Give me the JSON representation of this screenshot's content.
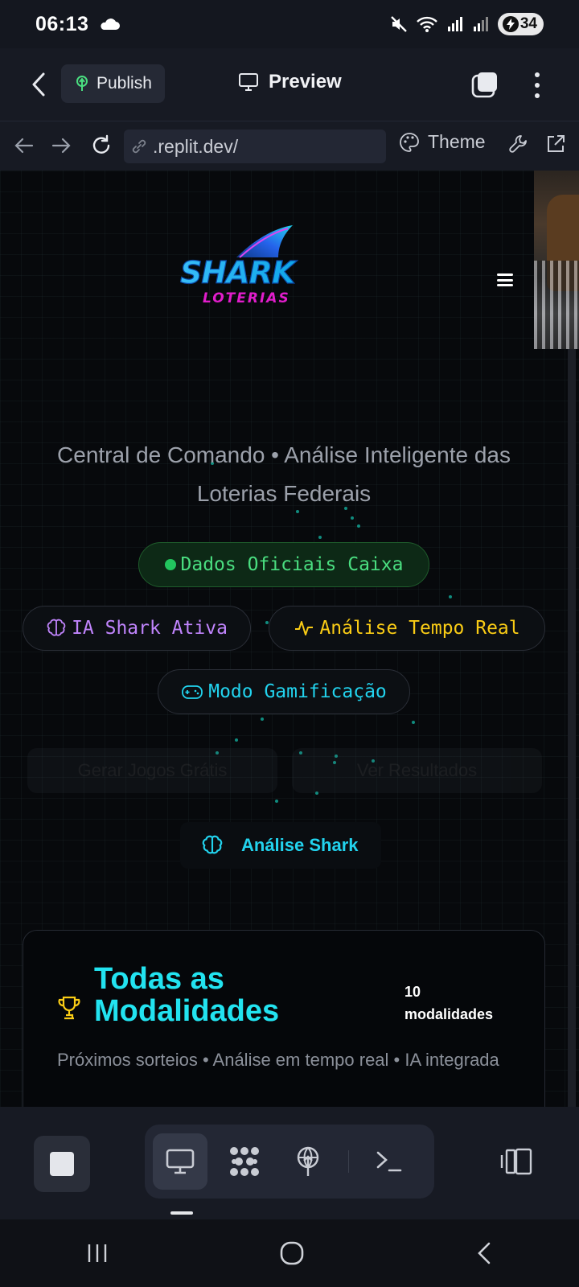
{
  "status_bar": {
    "time": "06:13",
    "battery": "34"
  },
  "app_bar": {
    "publish_label": "Publish",
    "title": "Preview"
  },
  "url_bar": {
    "url": ".replit.dev/",
    "theme_label": "Theme"
  },
  "hero": {
    "subtitle": "Central de Comando • Análise Inteligente das Loterias Federais",
    "badges": [
      {
        "label": "Dados Oficiais Caixa",
        "color": "#4ade80"
      },
      {
        "label": "IA Shark Ativa",
        "color": "#c084fc"
      },
      {
        "label": "Análise Tempo Real",
        "color": "#facc15"
      },
      {
        "label": "Modo Gamificação",
        "color": "#22d3ee"
      }
    ],
    "ghost_buttons": [
      "Gerar Jogos Grátis",
      "Ver Resultados"
    ],
    "analise_button": "Análise Shark"
  },
  "card": {
    "title": "Todas as Modalidades",
    "count_number": "10",
    "count_label": "modalidades",
    "description": "Próximos sorteios • Análise em tempo real • IA integrada"
  },
  "logo": {
    "main": "SHARK",
    "sub": "LOTERIAS"
  },
  "colors": {
    "accent_cyan": "#22d3ee",
    "accent_magenta": "#d946ef",
    "background": "#07090c"
  }
}
